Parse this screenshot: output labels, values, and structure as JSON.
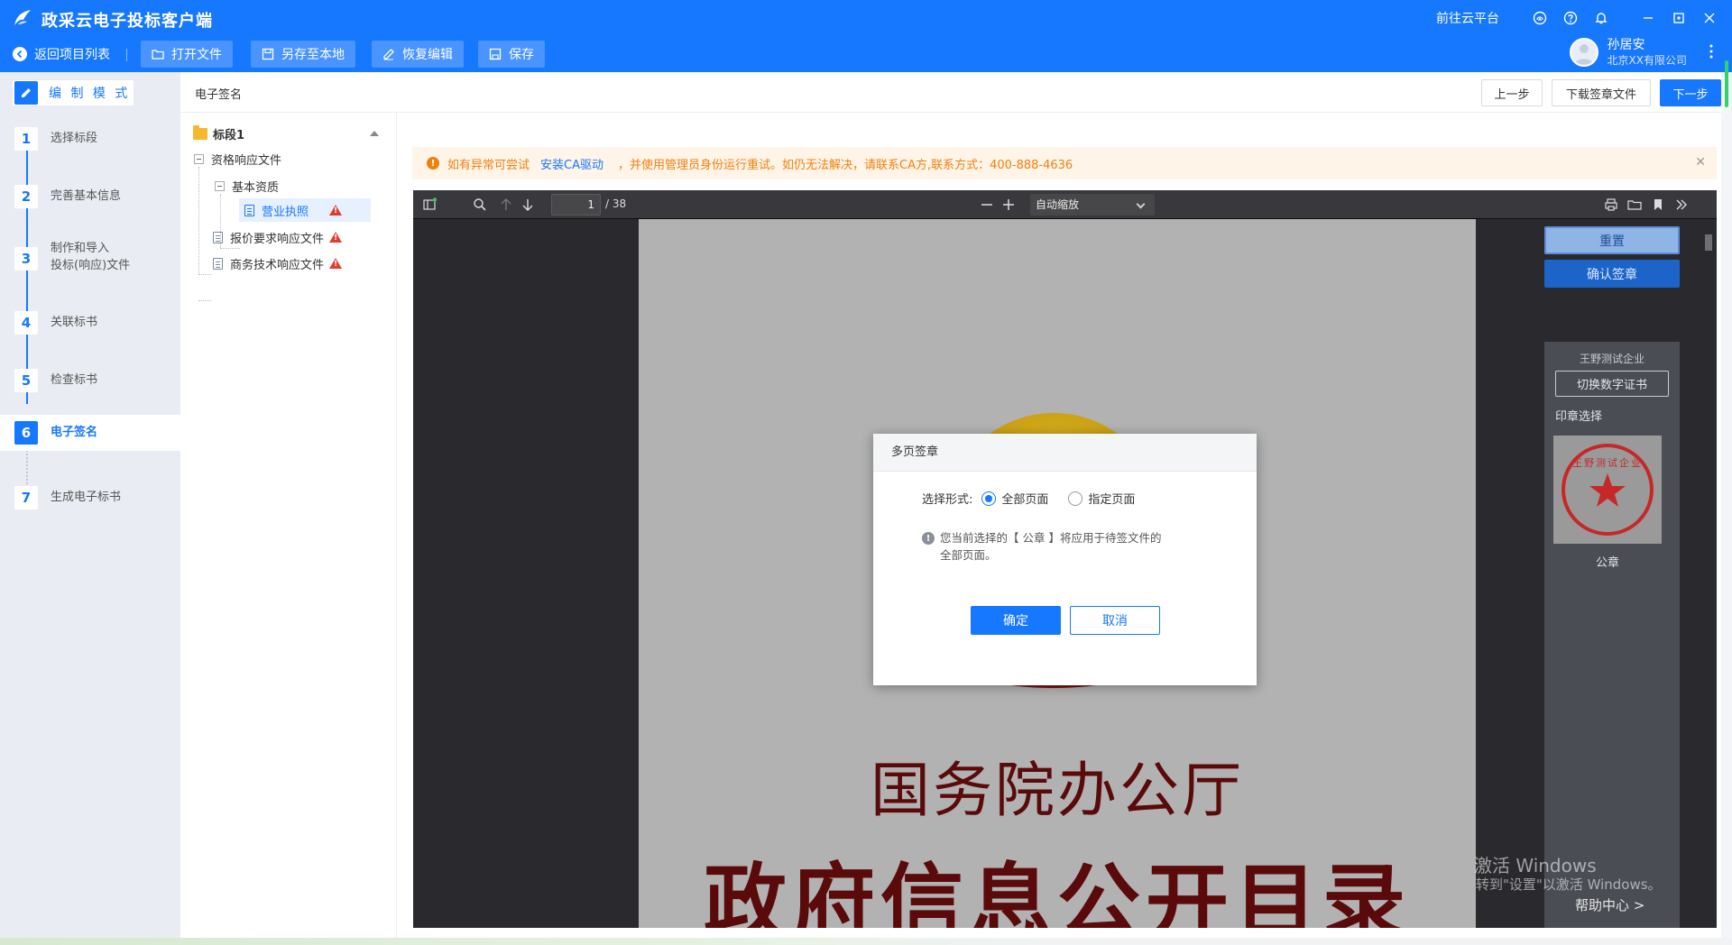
{
  "app": {
    "title": "政采云电子投标客户端",
    "cloud_platform": "前往云平台",
    "brand_color": "#1677ff"
  },
  "toolbar": {
    "back": "返回项目列表",
    "open_file": "打开文件",
    "save_local": "另存至本地",
    "restore_edit": "恢复编辑",
    "save": "保存"
  },
  "user": {
    "name": "孙居安",
    "org": "北京XX有限公司"
  },
  "sidebar": {
    "mode": "编 制 模 式",
    "steps": [
      {
        "num": "1",
        "label": "选择标段"
      },
      {
        "num": "2",
        "label": "完善基本信息"
      },
      {
        "num": "3",
        "label": "制作和导入",
        "label2": "投标(响应)文件"
      },
      {
        "num": "4",
        "label": "关联标书"
      },
      {
        "num": "5",
        "label": "检查标书"
      },
      {
        "num": "6",
        "label": "电子签名"
      },
      {
        "num": "7",
        "label": "生成电子标书"
      }
    ],
    "active_step": "6"
  },
  "content": {
    "breadcrumb": "电子签名",
    "prev": "上一步",
    "download": "下载签章文件",
    "next": "下一步"
  },
  "tree": {
    "root": "标段1",
    "nodes": [
      {
        "label": "资格响应文件"
      },
      {
        "label": "基本资质"
      },
      {
        "label": "营业执照",
        "selected": true,
        "warning": true
      },
      {
        "label": "报价要求响应文件",
        "warning": true
      },
      {
        "label": "商务技术响应文件",
        "warning": true
      }
    ]
  },
  "alert": {
    "text_before": "如有异常可尝试",
    "link": "安装CA驱动",
    "text_after": "，并使用管理员身份运行重试。如仍无法解决，请联系CA方,联系方式：400-888-4636"
  },
  "pdf": {
    "page": "1",
    "total": "/ 38",
    "zoom": "自动缩放",
    "title1": "国务院办公厅",
    "title2": "政府信息公开目录"
  },
  "seal_panel": {
    "reset": "重置",
    "confirm": "确认签章",
    "company": "王野测试企业",
    "switch_cert": "切换数字证书",
    "seal_select": "印章选择",
    "seal_name": "公章",
    "seal_text": "王野测试企业",
    "help": "帮助中心 >"
  },
  "watermark": {
    "line1": "激活 Windows",
    "line2": "转到\"设置\"以激活 Windows。"
  },
  "dialog": {
    "title": "多页签章",
    "form_label": "选择形式:",
    "option_all": "全部页面",
    "option_specific": "指定页面",
    "selected_option": "all",
    "note": "您当前选择的【 公章 】将应用于待签文件的全部页面。",
    "ok": "确定",
    "cancel": "取消"
  }
}
